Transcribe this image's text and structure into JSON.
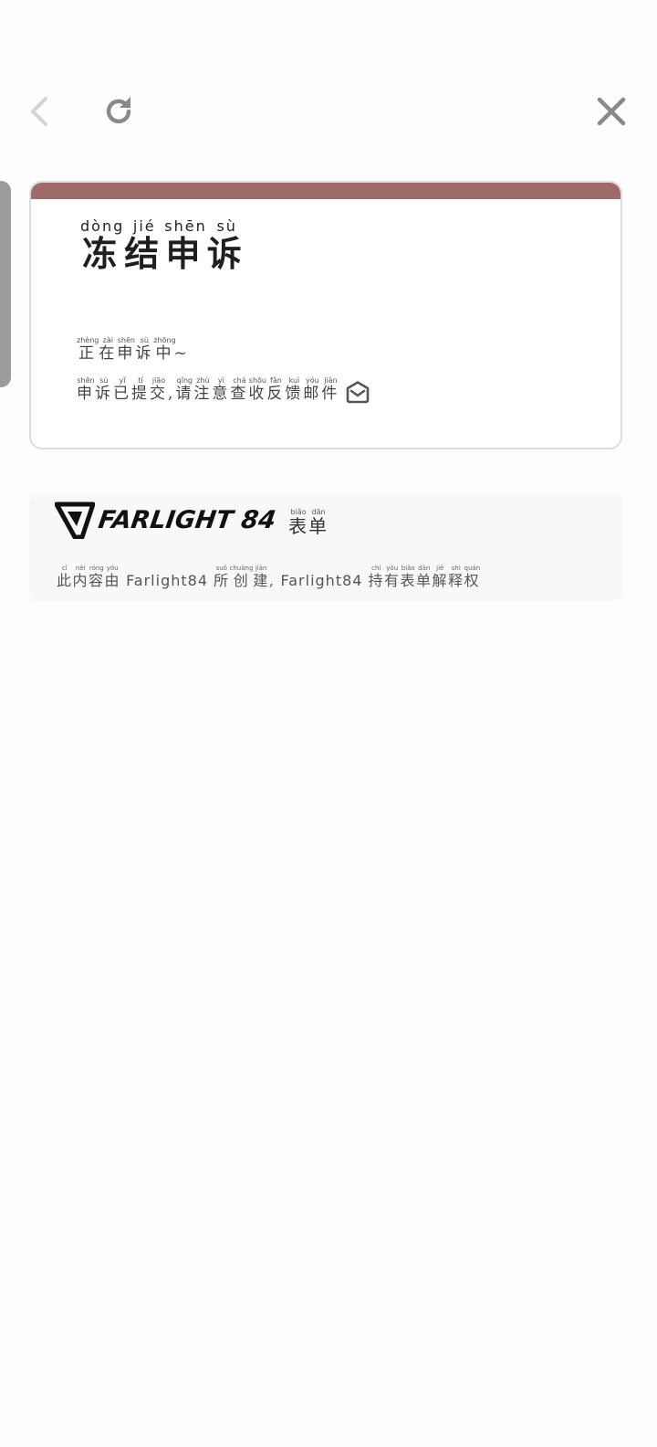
{
  "nav": {
    "back_icon": "chevron-left-icon",
    "reload_icon": "reload-icon",
    "close_icon": "close-icon",
    "icon_color": "#8a8a8a",
    "back_color": "#d4d4d4"
  },
  "card": {
    "accent_color": "#9e6b68",
    "title": {
      "chars": [
        "冻",
        "结",
        "申",
        "诉"
      ],
      "pinyin": [
        "dòng",
        "jié",
        "shēn",
        "sù"
      ]
    },
    "status_line_1": {
      "chars": [
        "正",
        "在",
        "申",
        "诉",
        "中"
      ],
      "pinyin": [
        "zhèng",
        "zài",
        "shēn",
        "sù",
        "zhōng"
      ],
      "suffix": "~"
    },
    "status_line_2": {
      "chars_a": [
        "申",
        "诉",
        "已",
        "提",
        "交"
      ],
      "pinyin_a": [
        "shēn",
        "sù",
        "yǐ",
        "tí",
        "jiāo"
      ],
      "comma": ",",
      "chars_b": [
        "请",
        "注",
        "意",
        "查",
        "收",
        "反",
        "馈",
        "邮",
        "件"
      ],
      "pinyin_b": [
        "qǐng",
        "zhù",
        "yì",
        "chá",
        "shōu",
        "fǎn",
        "kuì",
        "yóu",
        "jiàn"
      ],
      "icon": "mail-icon"
    }
  },
  "footer": {
    "brand_logo": "farlight84-logo-icon",
    "brand_name": "FARLIGHT 84",
    "form_label": {
      "chars": [
        "表",
        "单"
      ],
      "pinyin": [
        "biǎo",
        "dān"
      ]
    },
    "note": {
      "seg1_chars": [
        "此",
        "内",
        "容",
        "由"
      ],
      "seg1_pinyin": [
        "cǐ",
        "nèi",
        "róng",
        "yóu"
      ],
      "brand1": "Farlight84",
      "seg2_chars": [
        "所",
        "创",
        "建"
      ],
      "seg2_pinyin": [
        "suǒ",
        "chuàng",
        "jiàn"
      ],
      "comma": ",",
      "brand2": "Farlight84",
      "seg3_chars": [
        "持",
        "有",
        "表",
        "单",
        "解",
        "释",
        "权"
      ],
      "seg3_pinyin": [
        "chí",
        "yǒu",
        "biǎo",
        "dān",
        "jiě",
        "shì",
        "quán"
      ]
    }
  }
}
